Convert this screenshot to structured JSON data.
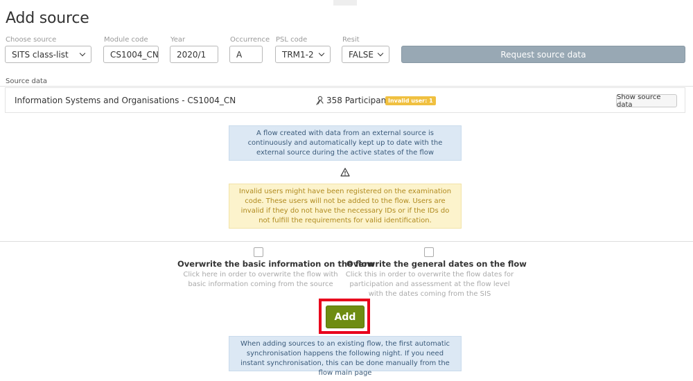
{
  "page": {
    "title": "Add source"
  },
  "form": {
    "choose_source": {
      "label": "Choose source",
      "value": "SITS class-list"
    },
    "module_code": {
      "label": "Module code",
      "value": "CS1004_CN"
    },
    "year": {
      "label": "Year",
      "value": "2020/1"
    },
    "occurrence": {
      "label": "Occurrence",
      "value": "A"
    },
    "psl_code": {
      "label": "PSL code",
      "value": "TRM1-2"
    },
    "resit": {
      "label": "Resit",
      "value": "FALSE"
    },
    "request_button": "Request source data"
  },
  "source_data": {
    "section_label": "Source data",
    "name": "Information Systems and Organisations - CS1004_CN",
    "participants": "358 Participants",
    "invalid_badge": "Invalid user: 1",
    "show_button": "Show source data"
  },
  "notices": {
    "external_source": "A flow created with data from an external source is continuously and automatically kept up to date with the external source during the active states of the flow",
    "invalid_users": "Invalid users might have been registered on the examination code. These users will not be added to the flow. Users are invalid if they do not have the necessary IDs or if the IDs do not fulfill the requirements for valid identification.",
    "sync": "When adding sources to an existing flow, the first automatic synchronisation happens the following night. If you need instant synchronisation, this can be done manually from the flow main page"
  },
  "options": {
    "overwrite_basic": {
      "title": "Overwrite the basic information on the flow",
      "description": "Click here in order to overwrite the flow with basic information coming from the source"
    },
    "overwrite_dates": {
      "title": "Overwrite the general dates on the flow",
      "description": "Click this in order to overwrite the flow dates for participation and assessment at the flow level with the dates coming from the SIS"
    }
  },
  "actions": {
    "add_button": "Add"
  },
  "colors": {
    "primary_action": "#6e8c12",
    "disabled_button": "#98a8b4",
    "highlight": "#e8001c",
    "info_blue": "#dce8f4",
    "info_yellow": "#fcf3cc",
    "badge_warning": "#f0c040"
  },
  "icons": {
    "participants": "participants-icon",
    "warning": "warning-triangle-icon",
    "dropdown": "chevron-down-icon"
  }
}
